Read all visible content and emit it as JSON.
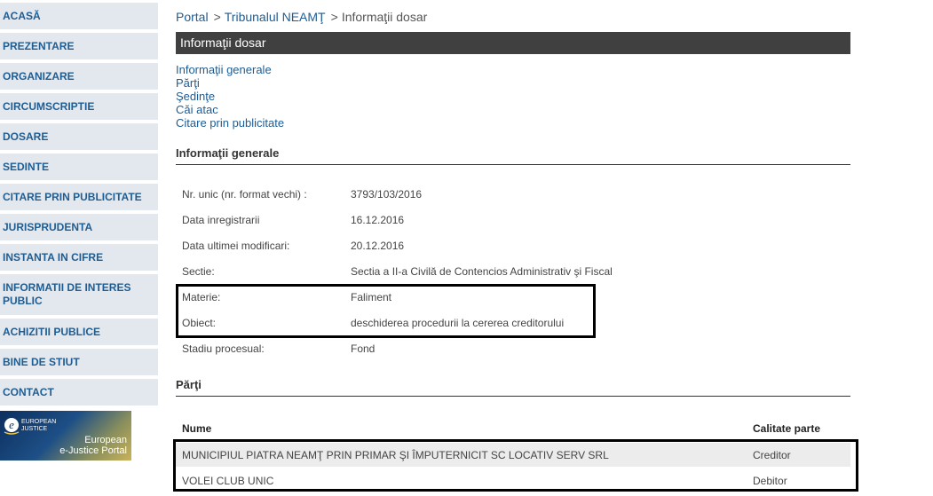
{
  "sidebar": {
    "items": [
      {
        "label": "ACASĂ"
      },
      {
        "label": "PREZENTARE"
      },
      {
        "label": "ORGANIZARE"
      },
      {
        "label": "CIRCUMSCRIPTIE"
      },
      {
        "label": "DOSARE"
      },
      {
        "label": "SEDINTE"
      },
      {
        "label": "CITARE PRIN PUBLICITATE"
      },
      {
        "label": "JURISPRUDENTA"
      },
      {
        "label": "INSTANTA IN CIFRE"
      },
      {
        "label": "INFORMATII DE INTERES PUBLIC"
      },
      {
        "label": "ACHIZITII PUBLICE"
      },
      {
        "label": "BINE DE STIUT"
      },
      {
        "label": "CONTACT"
      }
    ],
    "banner": {
      "logo_line1": "EUROPEAN",
      "logo_line2": "JUSTICE",
      "text_line1": "European",
      "text_line2": "e-Justice Portal"
    }
  },
  "breadcrumb": {
    "portal": "Portal",
    "court": "Tribunalul NEAMŢ",
    "current": "Informaţii dosar",
    "separator": ">"
  },
  "page_title": "Informaţii dosar",
  "tabs": [
    {
      "label": "Informaţii generale"
    },
    {
      "label": "Părţi"
    },
    {
      "label": "Şedinţe"
    },
    {
      "label": "Căi atac"
    },
    {
      "label": "Citare prin publicitate"
    }
  ],
  "general": {
    "heading": "Informaţii generale",
    "rows": [
      {
        "label": "Nr. unic (nr. format vechi) :",
        "value": "3793/103/2016"
      },
      {
        "label": "Data inregistrarii",
        "value": "16.12.2016"
      },
      {
        "label": "Data ultimei modificari:",
        "value": "20.12.2016"
      },
      {
        "label": "Sectie:",
        "value": "Sectia a II-a Civilă de Contencios Administrativ şi Fiscal"
      },
      {
        "label": "Materie:",
        "value": "Faliment"
      },
      {
        "label": "Obiect:",
        "value": "deschiderea procedurii la cererea creditorului"
      },
      {
        "label": "Stadiu procesual:",
        "value": "Fond"
      }
    ]
  },
  "parti": {
    "heading": "Părţi",
    "columns": {
      "name": "Nume",
      "role": "Calitate parte"
    },
    "rows": [
      {
        "name": "MUNICIPIUL PIATRA NEAMŢ PRIN PRIMAR ŞI ÎMPUTERNICIT SC LOCATIV SERV SRL",
        "role": "Creditor"
      },
      {
        "name": "VOLEI CLUB UNIC",
        "role": "Debitor"
      }
    ]
  },
  "colors": {
    "link": "#1e5d94",
    "nav_bg": "#e3e8ee",
    "title_bar": "#404040",
    "highlight_border": "#000000"
  }
}
